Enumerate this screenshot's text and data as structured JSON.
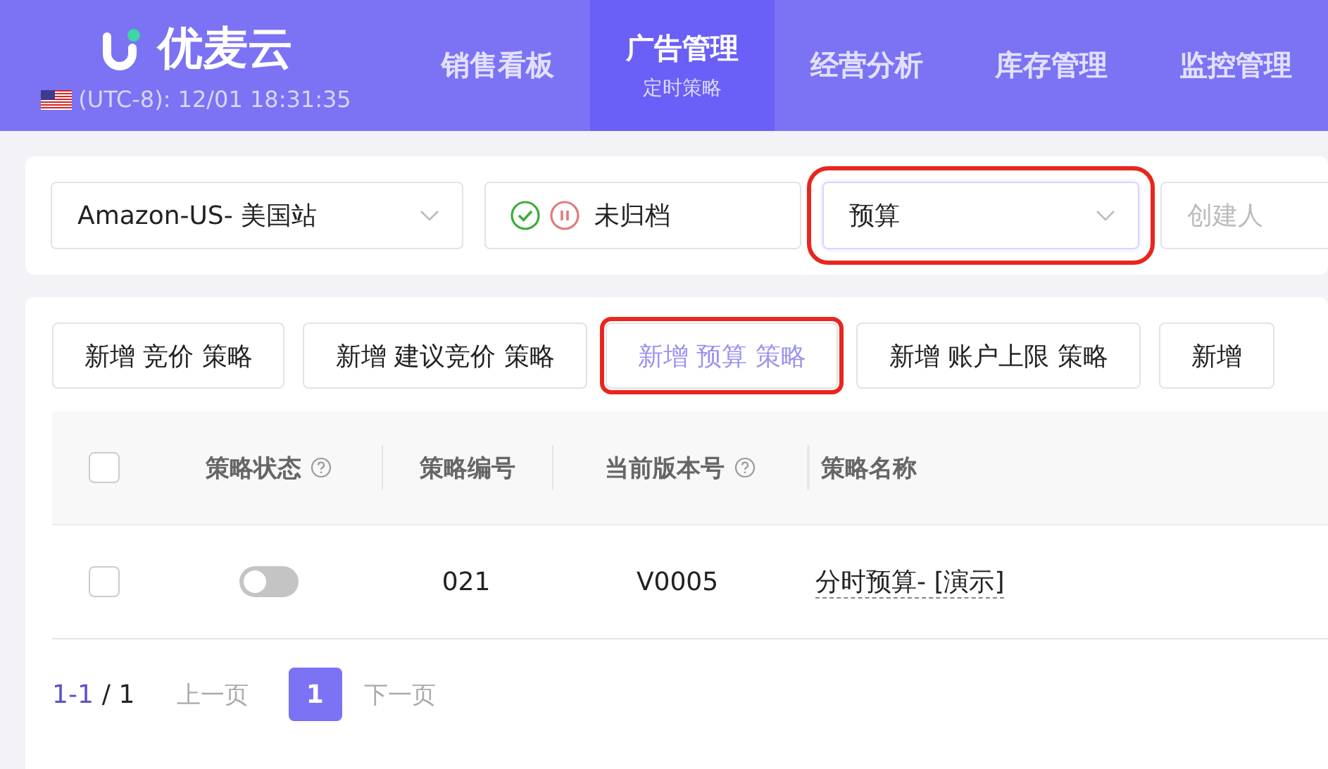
{
  "header": {
    "brand": "优麦云",
    "clock": "(UTC-8): 12/01 18:31:35",
    "nav": [
      {
        "label": "销售看板",
        "selected": false
      },
      {
        "label": "广告管理",
        "selected": true,
        "sub": "定时策略"
      },
      {
        "label": "经营分析",
        "selected": false
      },
      {
        "label": "库存管理",
        "selected": false
      },
      {
        "label": "监控管理",
        "selected": false
      }
    ]
  },
  "filters": [
    {
      "kind": "select",
      "value": "Amazon-US- 美国站",
      "highlighted": false
    },
    {
      "kind": "status",
      "value": "未归档"
    },
    {
      "kind": "select",
      "value": "预算",
      "highlighted": true
    },
    {
      "kind": "placeholder",
      "placeholder": "创建人"
    }
  ],
  "actions": [
    {
      "label": "新增 竞价 策略",
      "highlighted": false
    },
    {
      "label": "新增 建议竞价 策略",
      "highlighted": false
    },
    {
      "label": "新增 预算 策略",
      "highlighted": true
    },
    {
      "label": "新增 账户上限 策略",
      "highlighted": false
    },
    {
      "label": "新增",
      "highlighted": false
    }
  ],
  "table": {
    "all_checked": false,
    "columns": [
      {
        "label": "策略状态",
        "help": true
      },
      {
        "label": "策略编号",
        "help": false
      },
      {
        "label": "当前版本号",
        "help": true
      },
      {
        "label": "策略名称",
        "help": false
      }
    ],
    "rows": [
      {
        "checked": false,
        "on": false,
        "id": "021",
        "version": "V0005",
        "name": "分时预算- [演示]"
      }
    ]
  },
  "pagination": {
    "range": "1-1",
    "total": "/ 1",
    "prev": "上一页",
    "pages": [
      {
        "label": "1",
        "selected": true
      }
    ],
    "next": "下一页"
  }
}
